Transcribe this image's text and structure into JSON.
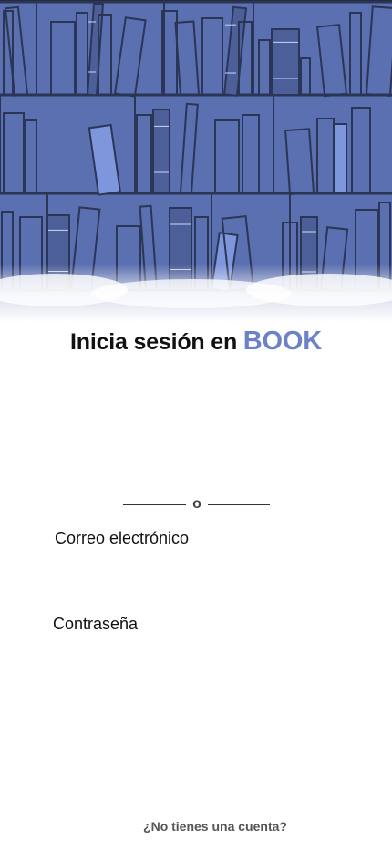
{
  "header": {
    "title_prefix": "Inicia sesión en",
    "brand": "BOOK"
  },
  "divider": {
    "label": "o"
  },
  "form": {
    "email_label": "Correo electrónico",
    "email_value": "",
    "password_label": "Contraseña",
    "password_value": ""
  },
  "footer": {
    "signup_prompt": "¿No tienes una cuenta?"
  },
  "colors": {
    "shelf_background": "#5b70b0",
    "shelf_lines": "#2b3556",
    "brand_accent": "#6b82c9",
    "text": "#111111"
  },
  "icons": {
    "hero_illustration": "bookshelf-illustration"
  }
}
